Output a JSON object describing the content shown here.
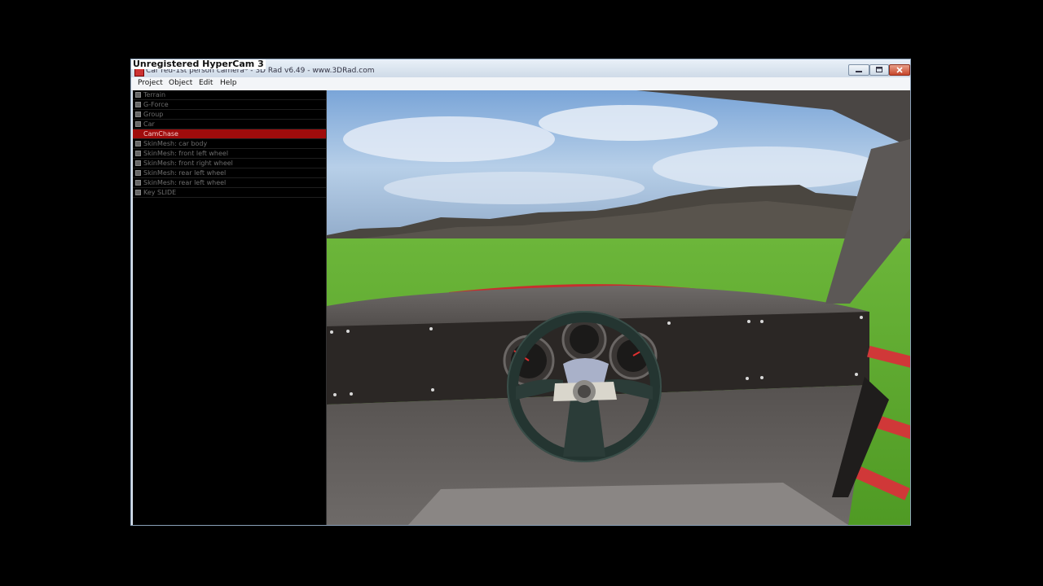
{
  "screen_recorder": {
    "watermark": "Unregistered HyperCam 3"
  },
  "window": {
    "title": "Car red-1st person camera* - 3D Rad v6.49 - www.3DRad.com",
    "controls": [
      "minimize-icon",
      "maximize-icon",
      "close-icon"
    ]
  },
  "menu": {
    "items": [
      {
        "label": "Project"
      },
      {
        "label": "Object"
      },
      {
        "label": "Edit"
      },
      {
        "label": "Help"
      }
    ]
  },
  "object_tree": {
    "selected_index": 4,
    "items": [
      {
        "label": "Terrain"
      },
      {
        "label": "G-Force"
      },
      {
        "label": "Group"
      },
      {
        "label": "Car"
      },
      {
        "label": "CamChase"
      },
      {
        "label": "SkinMesh: car body"
      },
      {
        "label": "SkinMesh: front left wheel"
      },
      {
        "label": "SkinMesh: front right wheel"
      },
      {
        "label": "SkinMesh: rear left wheel"
      },
      {
        "label": "SkinMesh: rear left wheel"
      },
      {
        "label": "Key SLIDE"
      }
    ]
  },
  "viewport": {
    "scene": "first-person car cockpit view over grass terrain with mountains",
    "colors": {
      "sky": "#8fb4de",
      "grass": "#5aa82c",
      "car_accent": "#d83030",
      "dashboard": "#2a2624"
    }
  }
}
